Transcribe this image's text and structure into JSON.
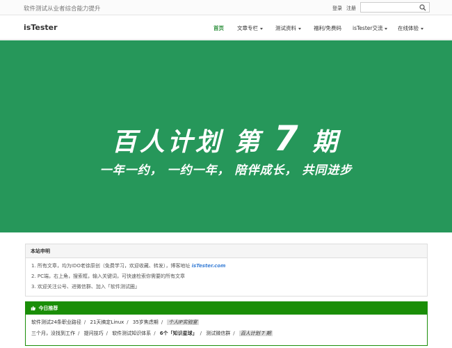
{
  "topbar": {
    "tagline": "软件测试从业者综合能力提升",
    "login": "登录",
    "register": "注册",
    "search_placeholder": ""
  },
  "navbar": {
    "brand": "isTester",
    "items": [
      {
        "label": "首页",
        "active": true,
        "dropdown": false
      },
      {
        "label": "文章专栏",
        "active": false,
        "dropdown": true
      },
      {
        "label": "测试资料",
        "active": false,
        "dropdown": true
      },
      {
        "label": "福利/免费码",
        "active": false,
        "dropdown": false
      },
      {
        "label": "isTester交流",
        "active": false,
        "dropdown": true
      },
      {
        "label": "在线体验",
        "active": false,
        "dropdown": true
      }
    ]
  },
  "banner": {
    "title_prefix": "百人计划 第",
    "title_number": "7",
    "title_suffix": "期",
    "slogan": "一年一约， 一约一年， 陪伴成长， 共同进步",
    "background": "#26975a"
  },
  "notice": {
    "title": "本站申明",
    "line1_text": "1. 所有文章，均为IDO老徐原创（免费学习，欢迎收藏、转发），博客地址",
    "line1_link": "isTester.com",
    "line2": "2. PC端，右上角，搜索框，输入关键词，可快速检索你需要的所有文章",
    "line3": "3. 欢迎关注公号、进微信群、加入「软件测试圈」"
  },
  "recommend": {
    "title": "今日推荐",
    "accent": "#1a8e07",
    "row1": [
      "软件测试24条职业路径",
      "21天搞定Linux",
      "35岁焦虑期",
      "个人IP实验室"
    ],
    "row2": [
      "三个月，没找到工作",
      "提问技巧",
      "软件测试知识体系",
      "6个「知识星球」",
      "测试微信群",
      "百人计划 7 期"
    ]
  }
}
